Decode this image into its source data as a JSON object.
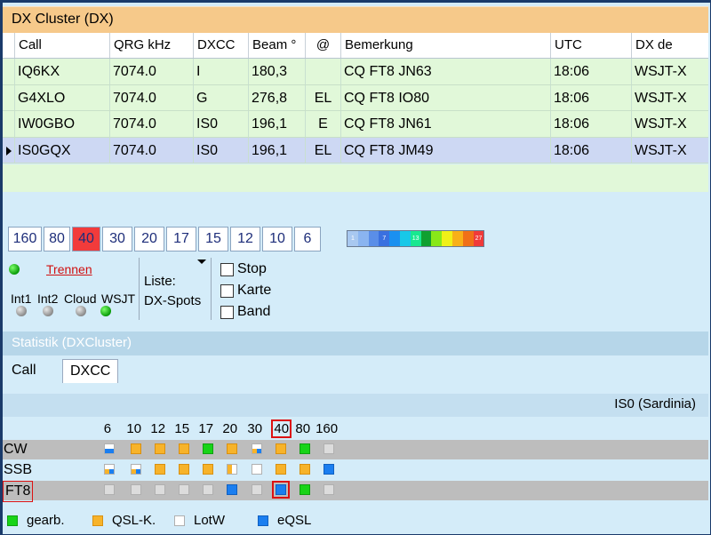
{
  "window": {
    "title": "DX Cluster (DX)"
  },
  "columns": [
    "Call",
    "QRG kHz",
    "DXCC",
    "Beam °",
    "@",
    "Bemerkung",
    "UTC",
    "DX de"
  ],
  "rows": [
    {
      "call": "IQ6KX",
      "qrg": "7074.0",
      "dxcc": "I",
      "beam": "180,3",
      "at": "",
      "remark": "CQ FT8 JN63",
      "utc": "18:06",
      "dxde": "WSJT-X",
      "selected": false
    },
    {
      "call": "G4XLO",
      "qrg": "7074.0",
      "dxcc": "G",
      "beam": "276,8",
      "at": "EL",
      "remark": "CQ FT8 IO80",
      "utc": "18:06",
      "dxde": "WSJT-X",
      "selected": false
    },
    {
      "call": "IW0GBO",
      "qrg": "7074.0",
      "dxcc": "IS0",
      "beam": "196,1",
      "at": "E",
      "remark": "CQ FT8 JN61",
      "utc": "18:06",
      "dxde": "WSJT-X",
      "selected": false
    },
    {
      "call": "IS0GQX",
      "qrg": "7074.0",
      "dxcc": "IS0",
      "beam": "196,1",
      "at": "EL",
      "remark": "CQ FT8 JM49",
      "utc": "18:06",
      "dxde": "WSJT-X",
      "selected": true
    }
  ],
  "band_buttons": [
    {
      "label": "160",
      "active": false
    },
    {
      "label": "80",
      "active": false
    },
    {
      "label": "40",
      "active": true
    },
    {
      "label": "30",
      "active": false
    },
    {
      "label": "20",
      "active": false
    },
    {
      "label": "17",
      "active": false
    },
    {
      "label": "15",
      "active": false
    },
    {
      "label": "12",
      "active": false
    },
    {
      "label": "10",
      "active": false
    },
    {
      "label": "6",
      "active": false
    }
  ],
  "scale": {
    "colors": [
      "#a8c8f0",
      "#8ab4f0",
      "#5a8ee8",
      "#3a70e0",
      "#1a90f0",
      "#18c8e8",
      "#18e890",
      "#10a030",
      "#88e818",
      "#f0f018",
      "#f8b018",
      "#f07018",
      "#f03a3a"
    ],
    "labels": [
      "1",
      "",
      "",
      "7",
      "",
      "",
      "13",
      "",
      "",
      "",
      "",
      "",
      "27"
    ]
  },
  "connection": {
    "disconnect_label": "Trennen",
    "indicators": [
      {
        "label": "Int1",
        "status": "gray"
      },
      {
        "label": "Int2",
        "status": "gray"
      },
      {
        "label": "Cloud",
        "status": "gray"
      },
      {
        "label": "WSJT",
        "status": "green"
      }
    ]
  },
  "list": {
    "label": "Liste:",
    "value": "DX-Spots"
  },
  "checkboxes": [
    {
      "label": "Stop",
      "checked": false
    },
    {
      "label": "Karte",
      "checked": false
    },
    {
      "label": "Band",
      "checked": false
    }
  ],
  "statistics": {
    "title": "Statistik (DXCluster)",
    "tabs": [
      {
        "label": "Call",
        "active": false
      },
      {
        "label": "DXCC",
        "active": true
      }
    ],
    "country": "IS0 (Sardinia)",
    "bands": [
      "6",
      "10",
      "12",
      "15",
      "17",
      "20",
      "30",
      "40",
      "80",
      "160"
    ],
    "highlight_band": "40",
    "modes": [
      {
        "label": "CW",
        "cells": [
          "split-bw",
          "orange",
          "orange",
          "orange",
          "green",
          "orange",
          "quad",
          "orange",
          "green",
          "empty"
        ]
      },
      {
        "label": "SSB",
        "cells": [
          "quad",
          "quad",
          "orange",
          "orange",
          "orange",
          "split-ow",
          "white",
          "orange",
          "orange",
          "blue"
        ]
      },
      {
        "label": "FT8",
        "cells": [
          "empty",
          "empty",
          "empty",
          "empty",
          "empty",
          "blue",
          "empty",
          "blue",
          "green",
          "empty"
        ]
      }
    ],
    "highlight_mode": "FT8"
  },
  "legend": [
    {
      "label": "gearb.",
      "color": "green"
    },
    {
      "label": "QSL-K.",
      "color": "orange"
    },
    {
      "label": "LotW",
      "color": "white"
    },
    {
      "label": "eQSL",
      "color": "blue"
    }
  ]
}
